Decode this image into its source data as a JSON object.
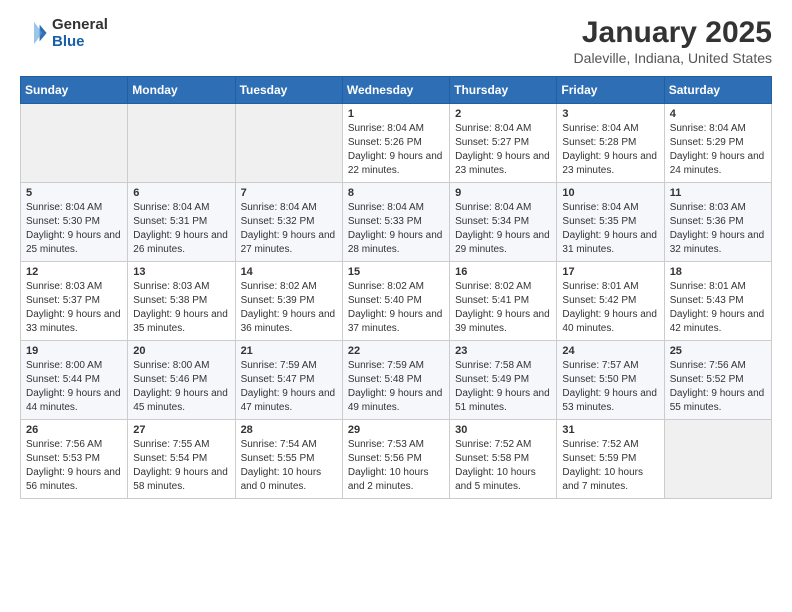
{
  "header": {
    "logo_general": "General",
    "logo_blue": "Blue",
    "title": "January 2025",
    "subtitle": "Daleville, Indiana, United States"
  },
  "calendar": {
    "days_of_week": [
      "Sunday",
      "Monday",
      "Tuesday",
      "Wednesday",
      "Thursday",
      "Friday",
      "Saturday"
    ],
    "weeks": [
      [
        {
          "day": "",
          "sunrise": "",
          "sunset": "",
          "daylight": "",
          "empty": true
        },
        {
          "day": "",
          "sunrise": "",
          "sunset": "",
          "daylight": "",
          "empty": true
        },
        {
          "day": "",
          "sunrise": "",
          "sunset": "",
          "daylight": "",
          "empty": true
        },
        {
          "day": "1",
          "sunrise": "Sunrise: 8:04 AM",
          "sunset": "Sunset: 5:26 PM",
          "daylight": "Daylight: 9 hours and 22 minutes."
        },
        {
          "day": "2",
          "sunrise": "Sunrise: 8:04 AM",
          "sunset": "Sunset: 5:27 PM",
          "daylight": "Daylight: 9 hours and 23 minutes."
        },
        {
          "day": "3",
          "sunrise": "Sunrise: 8:04 AM",
          "sunset": "Sunset: 5:28 PM",
          "daylight": "Daylight: 9 hours and 23 minutes."
        },
        {
          "day": "4",
          "sunrise": "Sunrise: 8:04 AM",
          "sunset": "Sunset: 5:29 PM",
          "daylight": "Daylight: 9 hours and 24 minutes."
        }
      ],
      [
        {
          "day": "5",
          "sunrise": "Sunrise: 8:04 AM",
          "sunset": "Sunset: 5:30 PM",
          "daylight": "Daylight: 9 hours and 25 minutes."
        },
        {
          "day": "6",
          "sunrise": "Sunrise: 8:04 AM",
          "sunset": "Sunset: 5:31 PM",
          "daylight": "Daylight: 9 hours and 26 minutes."
        },
        {
          "day": "7",
          "sunrise": "Sunrise: 8:04 AM",
          "sunset": "Sunset: 5:32 PM",
          "daylight": "Daylight: 9 hours and 27 minutes."
        },
        {
          "day": "8",
          "sunrise": "Sunrise: 8:04 AM",
          "sunset": "Sunset: 5:33 PM",
          "daylight": "Daylight: 9 hours and 28 minutes."
        },
        {
          "day": "9",
          "sunrise": "Sunrise: 8:04 AM",
          "sunset": "Sunset: 5:34 PM",
          "daylight": "Daylight: 9 hours and 29 minutes."
        },
        {
          "day": "10",
          "sunrise": "Sunrise: 8:04 AM",
          "sunset": "Sunset: 5:35 PM",
          "daylight": "Daylight: 9 hours and 31 minutes."
        },
        {
          "day": "11",
          "sunrise": "Sunrise: 8:03 AM",
          "sunset": "Sunset: 5:36 PM",
          "daylight": "Daylight: 9 hours and 32 minutes."
        }
      ],
      [
        {
          "day": "12",
          "sunrise": "Sunrise: 8:03 AM",
          "sunset": "Sunset: 5:37 PM",
          "daylight": "Daylight: 9 hours and 33 minutes."
        },
        {
          "day": "13",
          "sunrise": "Sunrise: 8:03 AM",
          "sunset": "Sunset: 5:38 PM",
          "daylight": "Daylight: 9 hours and 35 minutes."
        },
        {
          "day": "14",
          "sunrise": "Sunrise: 8:02 AM",
          "sunset": "Sunset: 5:39 PM",
          "daylight": "Daylight: 9 hours and 36 minutes."
        },
        {
          "day": "15",
          "sunrise": "Sunrise: 8:02 AM",
          "sunset": "Sunset: 5:40 PM",
          "daylight": "Daylight: 9 hours and 37 minutes."
        },
        {
          "day": "16",
          "sunrise": "Sunrise: 8:02 AM",
          "sunset": "Sunset: 5:41 PM",
          "daylight": "Daylight: 9 hours and 39 minutes."
        },
        {
          "day": "17",
          "sunrise": "Sunrise: 8:01 AM",
          "sunset": "Sunset: 5:42 PM",
          "daylight": "Daylight: 9 hours and 40 minutes."
        },
        {
          "day": "18",
          "sunrise": "Sunrise: 8:01 AM",
          "sunset": "Sunset: 5:43 PM",
          "daylight": "Daylight: 9 hours and 42 minutes."
        }
      ],
      [
        {
          "day": "19",
          "sunrise": "Sunrise: 8:00 AM",
          "sunset": "Sunset: 5:44 PM",
          "daylight": "Daylight: 9 hours and 44 minutes."
        },
        {
          "day": "20",
          "sunrise": "Sunrise: 8:00 AM",
          "sunset": "Sunset: 5:46 PM",
          "daylight": "Daylight: 9 hours and 45 minutes."
        },
        {
          "day": "21",
          "sunrise": "Sunrise: 7:59 AM",
          "sunset": "Sunset: 5:47 PM",
          "daylight": "Daylight: 9 hours and 47 minutes."
        },
        {
          "day": "22",
          "sunrise": "Sunrise: 7:59 AM",
          "sunset": "Sunset: 5:48 PM",
          "daylight": "Daylight: 9 hours and 49 minutes."
        },
        {
          "day": "23",
          "sunrise": "Sunrise: 7:58 AM",
          "sunset": "Sunset: 5:49 PM",
          "daylight": "Daylight: 9 hours and 51 minutes."
        },
        {
          "day": "24",
          "sunrise": "Sunrise: 7:57 AM",
          "sunset": "Sunset: 5:50 PM",
          "daylight": "Daylight: 9 hours and 53 minutes."
        },
        {
          "day": "25",
          "sunrise": "Sunrise: 7:56 AM",
          "sunset": "Sunset: 5:52 PM",
          "daylight": "Daylight: 9 hours and 55 minutes."
        }
      ],
      [
        {
          "day": "26",
          "sunrise": "Sunrise: 7:56 AM",
          "sunset": "Sunset: 5:53 PM",
          "daylight": "Daylight: 9 hours and 56 minutes."
        },
        {
          "day": "27",
          "sunrise": "Sunrise: 7:55 AM",
          "sunset": "Sunset: 5:54 PM",
          "daylight": "Daylight: 9 hours and 58 minutes."
        },
        {
          "day": "28",
          "sunrise": "Sunrise: 7:54 AM",
          "sunset": "Sunset: 5:55 PM",
          "daylight": "Daylight: 10 hours and 0 minutes."
        },
        {
          "day": "29",
          "sunrise": "Sunrise: 7:53 AM",
          "sunset": "Sunset: 5:56 PM",
          "daylight": "Daylight: 10 hours and 2 minutes."
        },
        {
          "day": "30",
          "sunrise": "Sunrise: 7:52 AM",
          "sunset": "Sunset: 5:58 PM",
          "daylight": "Daylight: 10 hours and 5 minutes."
        },
        {
          "day": "31",
          "sunrise": "Sunrise: 7:52 AM",
          "sunset": "Sunset: 5:59 PM",
          "daylight": "Daylight: 10 hours and 7 minutes."
        },
        {
          "day": "",
          "sunrise": "",
          "sunset": "",
          "daylight": "",
          "empty": true
        }
      ]
    ]
  }
}
